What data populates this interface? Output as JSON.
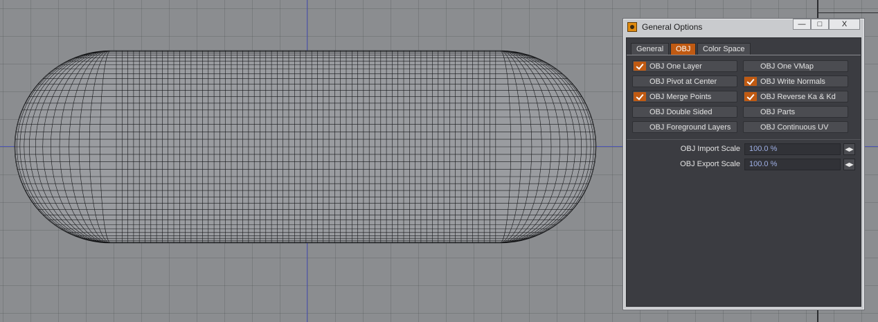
{
  "window": {
    "title": "General Options",
    "controls": {
      "minimize": "—",
      "maximize": "□",
      "close": "X"
    }
  },
  "tabs": [
    {
      "label": "General",
      "active": false
    },
    {
      "label": "OBJ",
      "active": true
    },
    {
      "label": "Color Space",
      "active": false
    }
  ],
  "options": {
    "one_layer": {
      "label": "OBJ One Layer",
      "checked": true
    },
    "one_vmap": {
      "label": "OBJ One VMap",
      "checked": false
    },
    "pivot_center": {
      "label": "OBJ Pivot at Center",
      "checked": false
    },
    "write_normals": {
      "label": "OBJ Write Normals",
      "checked": true
    },
    "merge_points": {
      "label": "OBJ Merge Points",
      "checked": true
    },
    "reverse_ka_kd": {
      "label": "OBJ Reverse Ka & Kd",
      "checked": true
    },
    "double_sided": {
      "label": "OBJ Double Sided",
      "checked": false
    },
    "parts": {
      "label": "OBJ Parts",
      "checked": false
    },
    "foreground_layers": {
      "label": "OBJ Foreground Layers",
      "checked": false
    },
    "continuous_uv": {
      "label": "OBJ Continuous UV",
      "checked": false
    }
  },
  "scales": {
    "import": {
      "label": "OBJ Import Scale",
      "value": "100.0 %"
    },
    "export": {
      "label": "OBJ Export Scale",
      "value": "100.0 %"
    }
  },
  "colors": {
    "accent": "#c05a12",
    "panel": "#3b3c41",
    "viewport": "#8b8d90",
    "axis": "#4f56b8"
  }
}
